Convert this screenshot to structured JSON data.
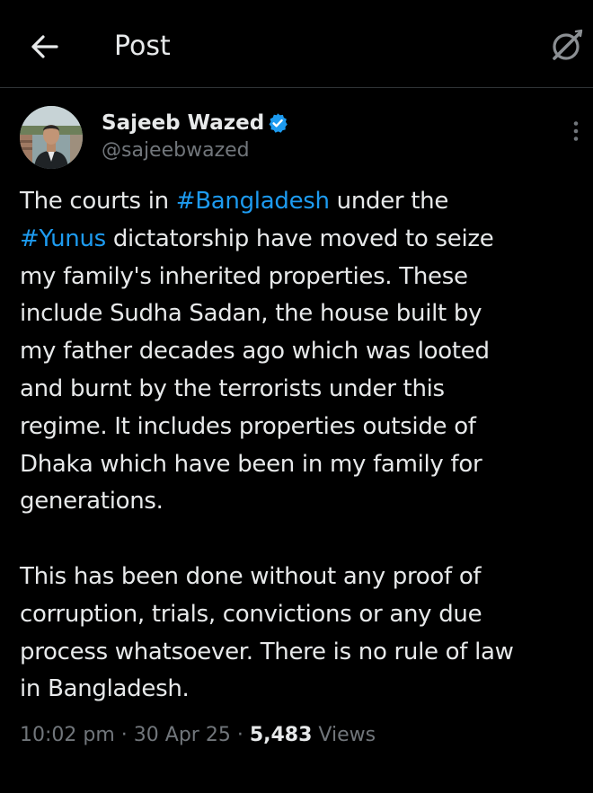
{
  "header": {
    "title": "Post",
    "back_icon": "arrow-left-icon",
    "grok_icon": "grok-icon"
  },
  "author": {
    "name": "Sajeeb Wazed",
    "handle": "@sajeebwazed",
    "verified": true,
    "verified_color": "#1d9bf0"
  },
  "tweet": {
    "lines": [
      {
        "parts": [
          {
            "t": "The courts in ",
            "tag": false
          },
          {
            "t": "#Bangladesh",
            "tag": true
          },
          {
            "t": " under the",
            "tag": false
          }
        ]
      },
      {
        "parts": [
          {
            "t": "#Yunus",
            "tag": true
          },
          {
            "t": " dictatorship have moved to seize",
            "tag": false
          }
        ]
      },
      {
        "parts": [
          {
            "t": "my family's inherited properties. These",
            "tag": false
          }
        ]
      },
      {
        "parts": [
          {
            "t": "include Sudha Sadan, the house built by",
            "tag": false
          }
        ]
      },
      {
        "parts": [
          {
            "t": "my father decades ago which was looted",
            "tag": false
          }
        ]
      },
      {
        "parts": [
          {
            "t": "and burnt by the terrorists under this",
            "tag": false
          }
        ]
      },
      {
        "parts": [
          {
            "t": "regime. It includes properties outside of",
            "tag": false
          }
        ]
      },
      {
        "parts": [
          {
            "t": "Dhaka which have been in my family for",
            "tag": false
          }
        ]
      },
      {
        "parts": [
          {
            "t": "generations.",
            "tag": false
          }
        ]
      },
      {
        "blank": true
      },
      {
        "parts": [
          {
            "t": "This has been done without any proof of",
            "tag": false
          }
        ]
      },
      {
        "parts": [
          {
            "t": "corruption, trials, convictions or any due",
            "tag": false
          }
        ]
      },
      {
        "parts": [
          {
            "t": "process whatsoever. There is no rule of law",
            "tag": false
          }
        ]
      },
      {
        "parts": [
          {
            "t": "in Bangladesh.",
            "tag": false
          }
        ]
      }
    ]
  },
  "meta": {
    "time": "10:02 pm",
    "separator": " · ",
    "date": "30 Apr 25",
    "views_count": "5,483",
    "views_label": " Views"
  },
  "colors": {
    "background": "#000000",
    "text": "#e7e9ea",
    "secondary": "#71767b",
    "link": "#1d9bf0",
    "divider": "#2f3336"
  }
}
